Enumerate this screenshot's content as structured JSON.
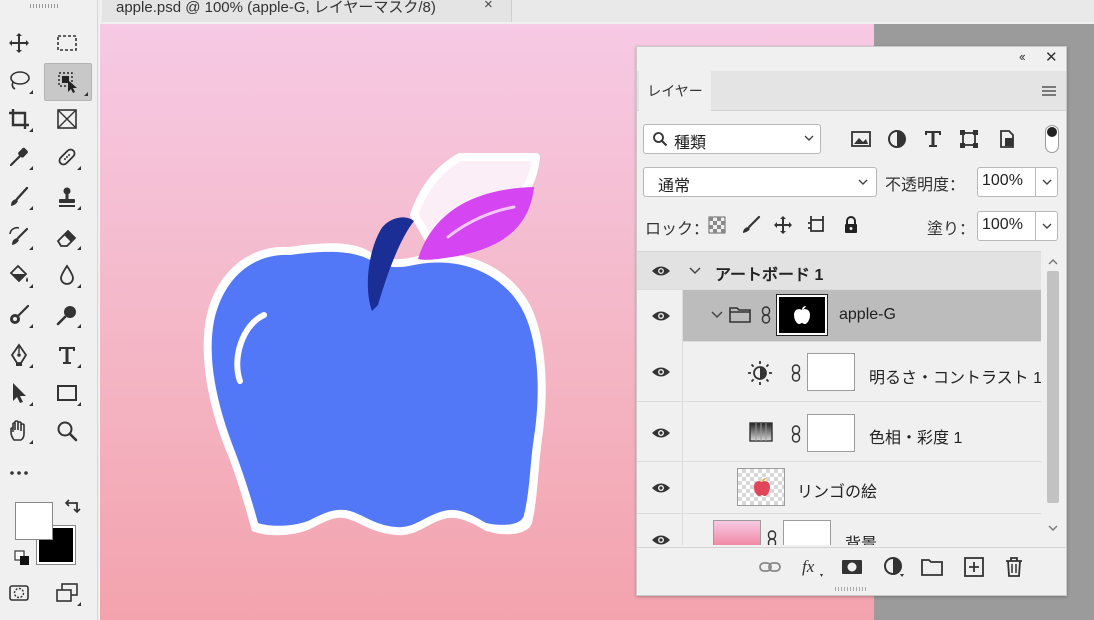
{
  "document": {
    "tab_title": "apple.psd @ 100% (apple-G, レイヤーマスク/8)",
    "close_glyph": "×"
  },
  "toolbar": {
    "tools": [
      {
        "name": "move-tool",
        "icon": "move-icon"
      },
      {
        "name": "rectangular-marquee-tool",
        "icon": "marquee-icon"
      },
      {
        "name": "lasso-tool",
        "icon": "lasso-icon"
      },
      {
        "name": "object-selection-tool",
        "icon": "object-selection-icon",
        "active": true
      },
      {
        "name": "crop-tool",
        "icon": "crop-icon"
      },
      {
        "name": "frame-tool",
        "icon": "frame-icon"
      },
      {
        "name": "eyedropper-tool",
        "icon": "eyedropper-icon"
      },
      {
        "name": "spot-healing-tool",
        "icon": "bandage-icon"
      },
      {
        "name": "brush-tool",
        "icon": "brush-icon"
      },
      {
        "name": "clone-stamp-tool",
        "icon": "stamp-icon"
      },
      {
        "name": "history-brush-tool",
        "icon": "history-brush-icon"
      },
      {
        "name": "eraser-tool",
        "icon": "eraser-icon"
      },
      {
        "name": "paint-bucket-tool",
        "icon": "bucket-icon"
      },
      {
        "name": "blur-tool",
        "icon": "drop-icon"
      },
      {
        "name": "dodge-tool",
        "icon": "dodge-icon"
      },
      {
        "name": "burn-tool",
        "icon": "burn-icon"
      },
      {
        "name": "pen-tool",
        "icon": "pen-icon"
      },
      {
        "name": "type-tool",
        "icon": "type-icon"
      },
      {
        "name": "path-selection-tool",
        "icon": "arrow-icon"
      },
      {
        "name": "rectangle-tool",
        "icon": "rectangle-icon"
      },
      {
        "name": "hand-tool",
        "icon": "hand-icon"
      },
      {
        "name": "zoom-tool",
        "icon": "zoom-icon"
      },
      {
        "name": "more-tools",
        "icon": "ellipsis-icon"
      }
    ],
    "foreground_color": "#ffffff",
    "background_color": "#000000"
  },
  "layers_panel": {
    "collapse_glyph": "‹‹",
    "close_glyph": "✕",
    "tab_label": "レイヤー",
    "filter_label": "種類",
    "blend_mode": "通常",
    "opacity_label": "不透明度：",
    "opacity_value": "100%",
    "lock_label": "ロック：",
    "fill_label": "塗り：",
    "fill_value": "100%",
    "layers": [
      {
        "name": "アートボード 1",
        "type": "artboard"
      },
      {
        "name": "apple-G",
        "type": "group",
        "selected": true
      },
      {
        "name": "明るさ・コントラスト 1",
        "type": "adjustment",
        "icon": "brightness-icon"
      },
      {
        "name": "色相・彩度 1",
        "type": "adjustment",
        "icon": "hue-saturation-icon"
      },
      {
        "name": "リンゴの絵",
        "type": "pixel"
      },
      {
        "name": "背景",
        "type": "pixel"
      }
    ]
  },
  "colors": {
    "apple_body": "#5378f7",
    "leaf": "#d545f2",
    "stem": "#1a2e96",
    "selected_layer": "#bcbcbc"
  }
}
